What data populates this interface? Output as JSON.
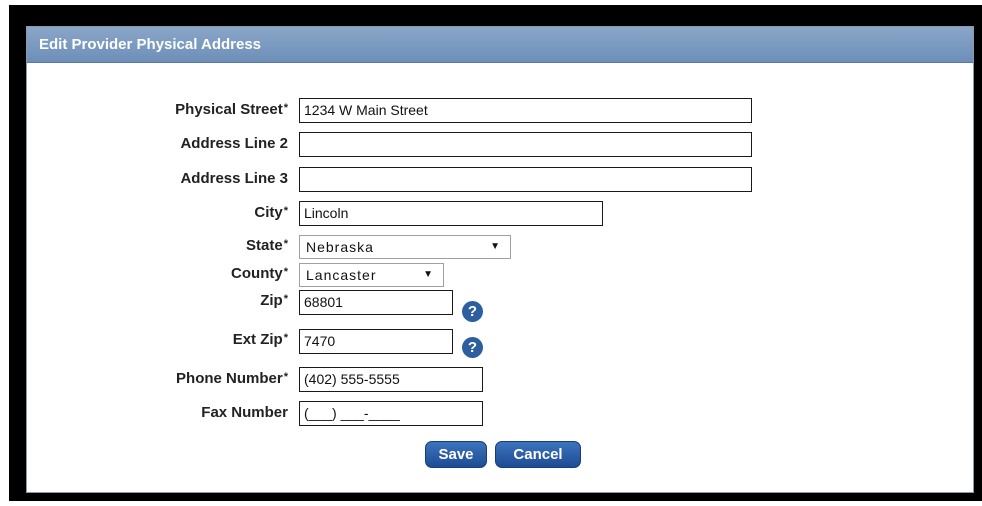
{
  "dialog": {
    "title": "Edit Provider Physical Address"
  },
  "fields": {
    "physical_street": {
      "label": "Physical Street",
      "required_mark": "*",
      "value": "1234 W Main Street"
    },
    "address_line_2": {
      "label": "Address Line 2",
      "value": ""
    },
    "address_line_3": {
      "label": "Address Line 3",
      "value": ""
    },
    "city": {
      "label": "City",
      "required_mark": "*",
      "value": "Lincoln"
    },
    "state": {
      "label": "State",
      "required_mark": "*",
      "value": "Nebraska"
    },
    "county": {
      "label": "County",
      "required_mark": "*",
      "value": "Lancaster"
    },
    "zip": {
      "label": "Zip",
      "required_mark": "*",
      "value": "68801",
      "help_icon": "?"
    },
    "ext_zip": {
      "label": "Ext Zip",
      "required_mark": "*",
      "value": "7470",
      "help_icon": "?"
    },
    "phone_number": {
      "label": "Phone Number",
      "required_mark": "*",
      "value": "(402) 555-5555"
    },
    "fax_number": {
      "label": "Fax Number",
      "value": "(___) ___-____"
    }
  },
  "buttons": {
    "save": "Save",
    "cancel": "Cancel"
  },
  "icons": {
    "dropdown": "▼"
  },
  "colors": {
    "titlebar": "#7b9bc2",
    "button": "#2a5ea8",
    "help_icon": "#2d5fa0"
  }
}
